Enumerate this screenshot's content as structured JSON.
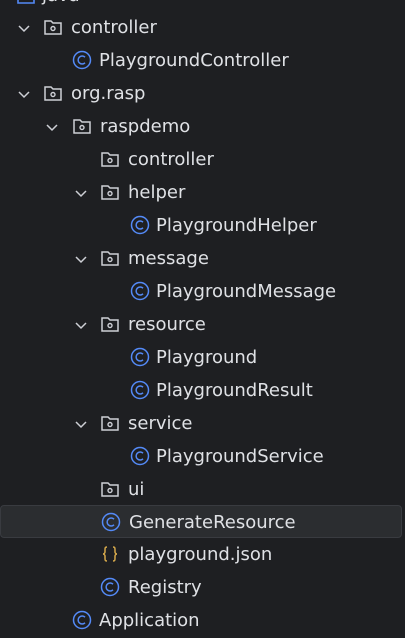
{
  "tree": {
    "top_partial_label": "java",
    "nodes": [
      {
        "id": "controller-1",
        "label": "controller",
        "icon": "folder-package-icon",
        "expanded": true
      },
      {
        "id": "PlaygroundController",
        "label": "PlaygroundController",
        "icon": "class-icon"
      },
      {
        "id": "org-rasp",
        "label": "org.rasp",
        "icon": "folder-package-icon",
        "expanded": true
      },
      {
        "id": "raspdemo",
        "label": "raspdemo",
        "icon": "folder-package-icon",
        "expanded": true
      },
      {
        "id": "controller-2",
        "label": "controller",
        "icon": "folder-package-icon"
      },
      {
        "id": "helper",
        "label": "helper",
        "icon": "folder-package-icon",
        "expanded": true
      },
      {
        "id": "PlaygroundHelper",
        "label": "PlaygroundHelper",
        "icon": "class-icon"
      },
      {
        "id": "message",
        "label": "message",
        "icon": "folder-package-icon",
        "expanded": true
      },
      {
        "id": "PlaygroundMessage",
        "label": "PlaygroundMessage",
        "icon": "class-icon"
      },
      {
        "id": "resource",
        "label": "resource",
        "icon": "folder-package-icon",
        "expanded": true
      },
      {
        "id": "Playground",
        "label": "Playground",
        "icon": "class-icon"
      },
      {
        "id": "PlaygroundResult",
        "label": "PlaygroundResult",
        "icon": "class-icon"
      },
      {
        "id": "service",
        "label": "service",
        "icon": "folder-package-icon",
        "expanded": true
      },
      {
        "id": "PlaygroundService",
        "label": "PlaygroundService",
        "icon": "class-icon"
      },
      {
        "id": "ui",
        "label": "ui",
        "icon": "folder-package-icon"
      },
      {
        "id": "GenerateResource",
        "label": "GenerateResource",
        "icon": "class-icon",
        "selected": true
      },
      {
        "id": "playground-json",
        "label": "playground.json",
        "icon": "json-file-icon"
      },
      {
        "id": "Registry",
        "label": "Registry",
        "icon": "class-icon"
      },
      {
        "id": "Application",
        "label": "Application",
        "icon": "class-icon"
      }
    ]
  },
  "colors": {
    "background": "#1e1f22",
    "text": "#dfe1e5",
    "class_icon": "#548af7",
    "json_icon": "#d5a84b",
    "folder_icon": "#ced0d6",
    "chevron": "#ced0d6",
    "selected_row": "#2b2d30"
  }
}
